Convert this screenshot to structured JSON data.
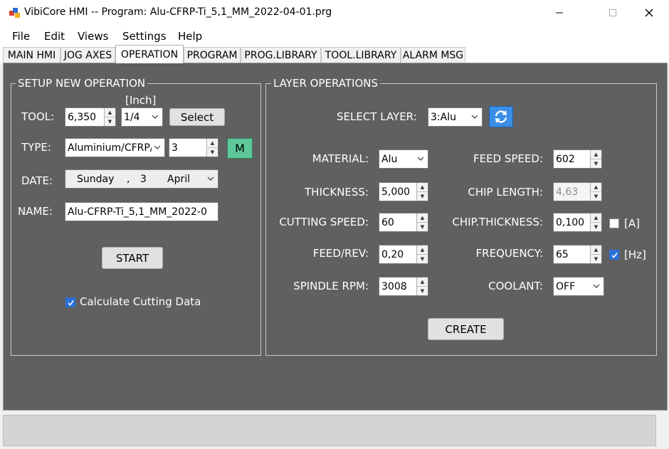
{
  "window": {
    "title": "VibiCore HMI -- Program: Alu-CFRP-Ti_5,1_MM_2022-04-01.prg",
    "minimize_glyph": "—",
    "maximize_glyph": "☐",
    "close_glyph": "✕"
  },
  "menu": [
    "File",
    "Edit",
    "Views",
    "Settings",
    "Help"
  ],
  "tabs": [
    "MAIN HMI",
    "JOG AXES",
    "OPERATION",
    "PROGRAM",
    "PROG.LIBRARY",
    "TOOL.LIBRARY",
    "ALARM MSG"
  ],
  "active_tab": "OPERATION",
  "setup": {
    "title": "SETUP NEW OPERATION",
    "unit_label": "[Inch]",
    "tool_label": "TOOL:",
    "tool_value": "6,350",
    "tool_inch": "1/4",
    "select_button": "Select",
    "type_label": "TYPE:",
    "type_value": "Aluminium/CFRP/",
    "type_number": "3",
    "m_button": "M",
    "date_label": "DATE:",
    "date_day": "Sunday",
    "date_sep": ",",
    "date_num": "3",
    "date_month": "April",
    "name_label": "NAME:",
    "name_value": "Alu-CFRP-Ti_5,1_MM_2022-0",
    "start_button": "START",
    "calc_label": "Calculate Cutting Data",
    "calc_checked": true
  },
  "layer": {
    "title": "LAYER OPERATIONS",
    "select_label": "SELECT LAYER:",
    "select_value": "3:Alu",
    "material_label": "MATERIAL:",
    "material_value": "Alu",
    "thickness_label": "THICKNESS:",
    "thickness_value": "5,000",
    "cutting_speed_label": "CUTTING SPEED:",
    "cutting_speed_value": "60",
    "feed_rev_label": "FEED/REV:",
    "feed_rev_value": "0,20",
    "spindle_label": "SPINDLE RPM:",
    "spindle_value": "3008",
    "feed_speed_label": "FEED SPEED:",
    "feed_speed_value": "602",
    "chip_length_label": "CHIP LENGTH:",
    "chip_length_value": "4,63",
    "chip_thickness_label": "CHIP.THICKNESS:",
    "chip_thickness_value": "0,100",
    "a_label": "[A]",
    "a_checked": false,
    "frequency_label": "FREQUENCY:",
    "frequency_value": "65",
    "hz_label": "[Hz]",
    "hz_checked": true,
    "coolant_label": "COOLANT:",
    "coolant_value": "OFF",
    "create_button": "CREATE"
  },
  "colors": {
    "panel": "#606060",
    "m_button": "#5ec89a",
    "refresh_button": "#3a8ee6",
    "check_accent": "#2b6fd6"
  }
}
